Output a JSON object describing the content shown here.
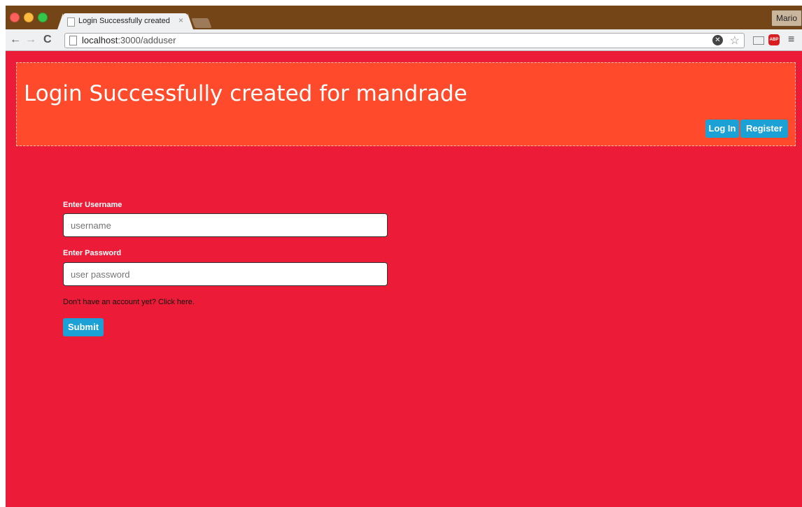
{
  "browser": {
    "tab_title": "Login Successfully created",
    "tab_close": "×",
    "profile": "Mario",
    "url_host": "localhost",
    "url_path": ":3000/adduser",
    "nav": {
      "back": "←",
      "forward": "→",
      "reload": "C"
    },
    "star": "☆",
    "menu": "≡",
    "abp": "ABP"
  },
  "page": {
    "heading": "Login Successfully created for mandrade",
    "nav_buttons": {
      "login": "Log In",
      "register": "Register"
    },
    "form": {
      "username_label": "Enter Username",
      "username_placeholder": "username",
      "password_label": "Enter Password",
      "password_placeholder": "user password",
      "hint": "Don't have an account yet? Click here.",
      "submit": "Submit"
    }
  },
  "colors": {
    "page_bg": "#ec1c38",
    "banner_bg": "#ff4b2b",
    "button_bg": "#1ba1d6",
    "titlebar_bg": "#744516"
  }
}
